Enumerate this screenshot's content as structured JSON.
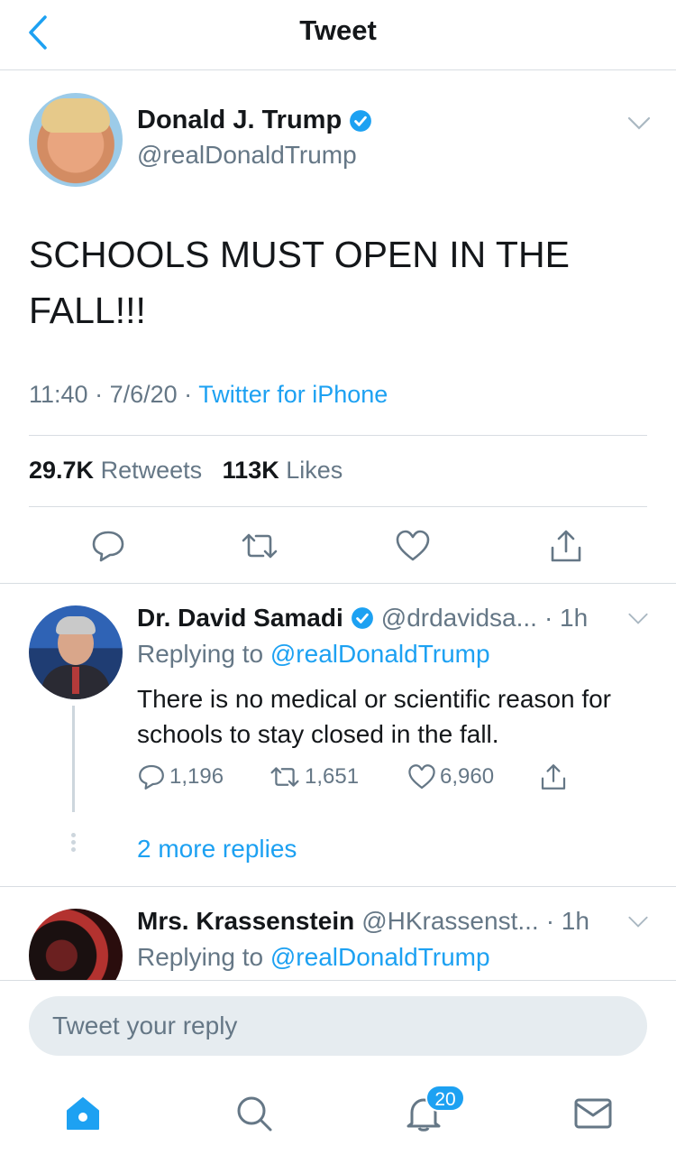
{
  "header": {
    "title": "Tweet"
  },
  "tweet": {
    "author_name": "Donald J. Trump",
    "author_handle": "@realDonaldTrump",
    "text": "SCHOOLS MUST OPEN IN THE FALL!!!",
    "time": "11:40",
    "date": "7/6/20",
    "source": "Twitter for iPhone",
    "retweets_count": "29.7K",
    "retweets_label": "Retweets",
    "likes_count": "113K",
    "likes_label": "Likes"
  },
  "replies": [
    {
      "name": "Dr. David Samadi",
      "handle": "@drdavidsa...",
      "age": "· 1h",
      "replying_prefix": "Replying to",
      "replying_to": "@realDonaldTrump",
      "text": "There is no medical or scientific reason for schools to stay closed in the fall.",
      "reply_count": "1,196",
      "retweet_count": "1,651",
      "like_count": "6,960",
      "more_replies": "2 more replies"
    },
    {
      "name": "Mrs. Krassenstein",
      "handle": "@HKrassenst...",
      "age": "· 1h",
      "replying_prefix": "Replying to",
      "replying_to": "@realDonaldTrump"
    }
  ],
  "composer": {
    "placeholder": "Tweet your reply"
  },
  "tabbar": {
    "notifications_badge": "20"
  },
  "colors": {
    "accent": "#1da1f2",
    "text": "#14171a",
    "muted": "#657786",
    "divider": "#d8dde2"
  },
  "icons": [
    "back-chevron-icon",
    "verified-badge-icon",
    "chevron-down-icon",
    "reply-icon",
    "retweet-icon",
    "like-icon",
    "share-icon",
    "home-icon",
    "search-icon",
    "notifications-icon",
    "messages-icon"
  ]
}
